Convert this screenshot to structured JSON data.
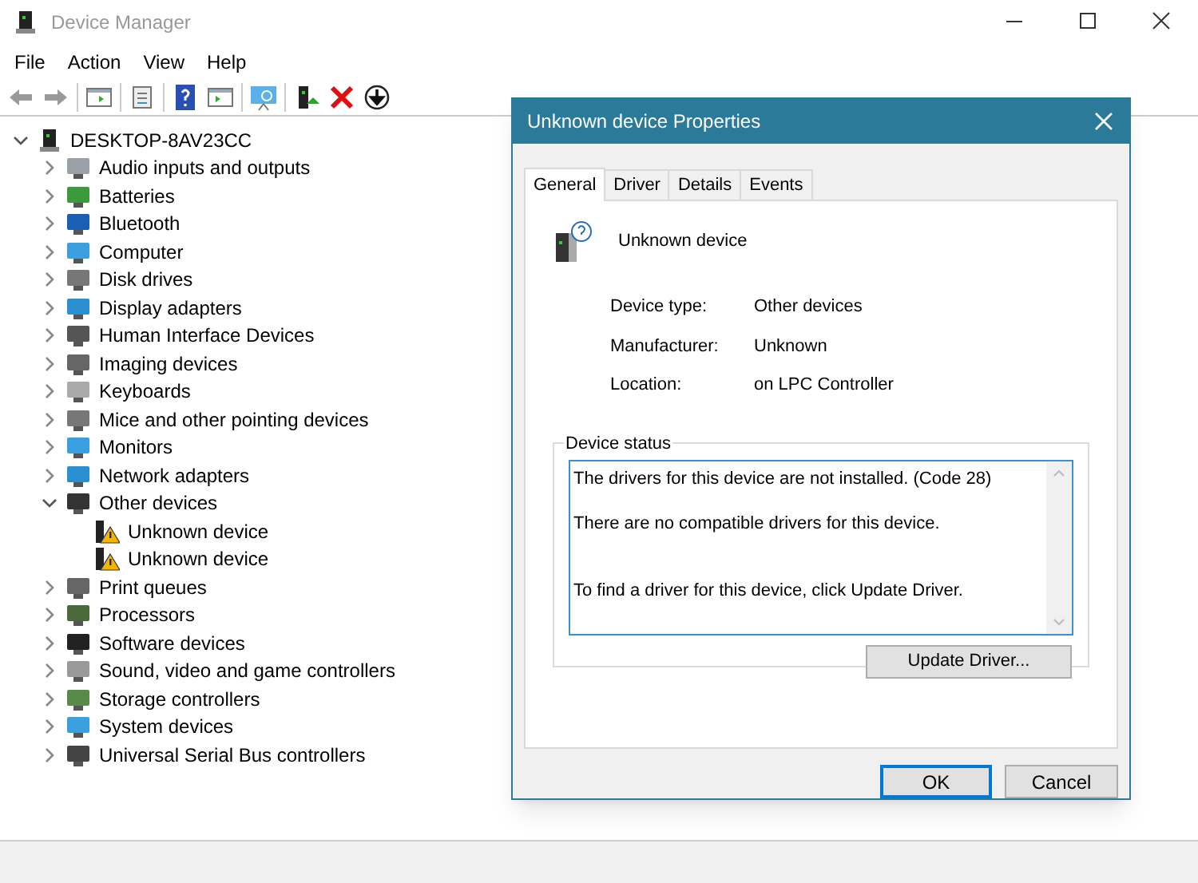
{
  "window": {
    "title": "Device Manager"
  },
  "menu": [
    "File",
    "Action",
    "View",
    "Help"
  ],
  "tree": {
    "label": "DESKTOP-8AV23CC",
    "expanded": true,
    "children": [
      {
        "label": "Audio inputs and outputs",
        "expanded": false
      },
      {
        "label": "Batteries",
        "expanded": false
      },
      {
        "label": "Bluetooth",
        "expanded": false
      },
      {
        "label": "Computer",
        "expanded": false
      },
      {
        "label": "Disk drives",
        "expanded": false
      },
      {
        "label": "Display adapters",
        "expanded": false
      },
      {
        "label": "Human Interface Devices",
        "expanded": false
      },
      {
        "label": "Imaging devices",
        "expanded": false
      },
      {
        "label": "Keyboards",
        "expanded": false
      },
      {
        "label": "Mice and other pointing devices",
        "expanded": false
      },
      {
        "label": "Monitors",
        "expanded": false
      },
      {
        "label": "Network adapters",
        "expanded": false
      },
      {
        "label": "Other devices",
        "expanded": true,
        "children": [
          {
            "label": "Unknown device",
            "warning": true
          },
          {
            "label": "Unknown device",
            "warning": true
          }
        ]
      },
      {
        "label": "Print queues",
        "expanded": false
      },
      {
        "label": "Processors",
        "expanded": false
      },
      {
        "label": "Software devices",
        "expanded": false
      },
      {
        "label": "Sound, video and game controllers",
        "expanded": false
      },
      {
        "label": "Storage controllers",
        "expanded": false
      },
      {
        "label": "System devices",
        "expanded": false
      },
      {
        "label": "Universal Serial Bus controllers",
        "expanded": false
      }
    ]
  },
  "dialog": {
    "title": "Unknown device Properties",
    "tabs": [
      {
        "label": "General",
        "selected": true
      },
      {
        "label": "Driver",
        "selected": false
      },
      {
        "label": "Details",
        "selected": false
      },
      {
        "label": "Events",
        "selected": false
      }
    ],
    "device_name": "Unknown device",
    "properties": [
      {
        "label": "Device type:",
        "value": "Other devices"
      },
      {
        "label": "Manufacturer:",
        "value": "Unknown"
      },
      {
        "label": "Location:",
        "value": "on LPC Controller"
      }
    ],
    "status_group": "Device status",
    "status_lines": [
      "The drivers for this device are not installed. (Code 28)",
      "There are no compatible drivers for this device.",
      "To find a driver for this device, click Update Driver."
    ],
    "update_button": "Update Driver...",
    "buttons": [
      {
        "label": "OK",
        "kind": "default"
      },
      {
        "label": "Cancel",
        "kind": "normal"
      }
    ]
  }
}
